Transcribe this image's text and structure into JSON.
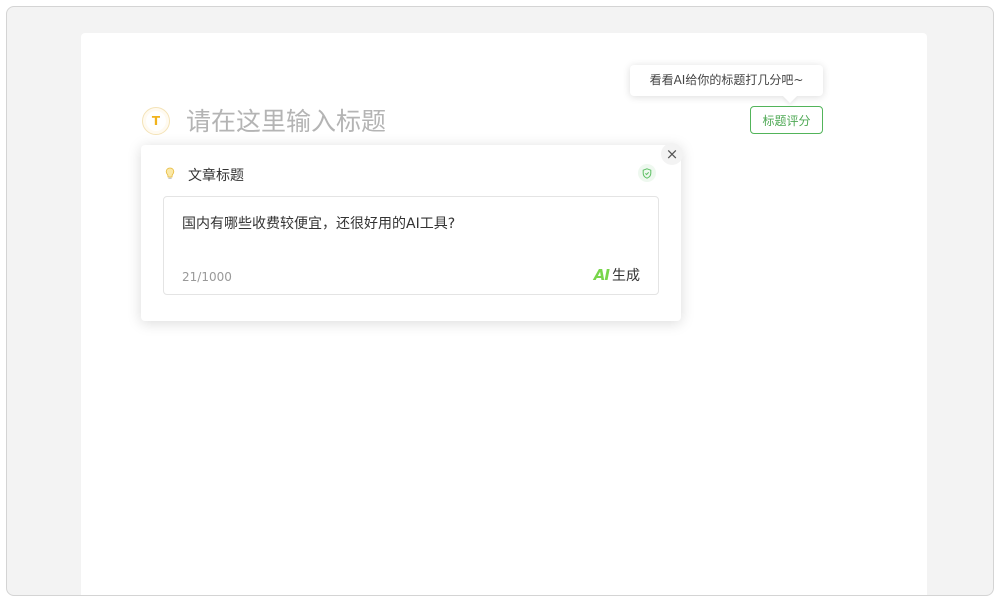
{
  "tooltip": {
    "text": "看看AI给你的标题打几分吧~"
  },
  "score_button": {
    "label": "标题评分"
  },
  "title": {
    "badge": "T",
    "placeholder": "请在这里输入标题"
  },
  "popup": {
    "close_label": "×",
    "label": "文章标题",
    "text": "国内有哪些收费较便宜，还很好用的AI工具?",
    "char_count": "21/1000",
    "ai_logo": "AI",
    "generate_label": "生成"
  },
  "colors": {
    "accent_green": "#52b45a",
    "ai_green": "#78d64b",
    "badge_yellow": "#f1b31c"
  },
  "icons": {
    "bulb": "lightbulb-icon",
    "shield": "shield-icon",
    "close": "close-icon",
    "title": "title-t-icon"
  }
}
